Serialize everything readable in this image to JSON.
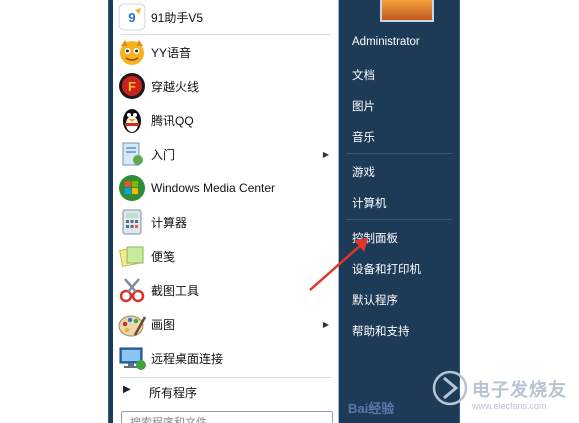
{
  "programs": [
    {
      "label": "91助手V5",
      "icon": "91-assistant-icon"
    },
    {
      "label": "YY语音",
      "icon": "yy-voice-icon"
    },
    {
      "label": "穿越火线",
      "icon": "crossfire-icon"
    },
    {
      "label": "腾讯QQ",
      "icon": "qq-penguin-icon"
    },
    {
      "label": "入门",
      "icon": "getting-started-icon",
      "submenu": true
    },
    {
      "label": "Windows Media Center",
      "icon": "windows-media-center-icon"
    },
    {
      "label": "计算器",
      "icon": "calculator-icon"
    },
    {
      "label": "便笺",
      "icon": "sticky-notes-icon"
    },
    {
      "label": "截图工具",
      "icon": "snipping-tool-icon"
    },
    {
      "label": "画图",
      "icon": "paint-icon",
      "submenu": true
    },
    {
      "label": "远程桌面连接",
      "icon": "remote-desktop-icon"
    }
  ],
  "all_programs": {
    "label": "所有程序"
  },
  "search": {
    "placeholder": "搜索程序和文件"
  },
  "right_menu": {
    "user": "Administrator",
    "items": [
      "文档",
      "图片",
      "音乐",
      "游戏",
      "计算机",
      "控制面板",
      "设备和打印机",
      "默认程序",
      "帮助和支持"
    ]
  },
  "watermarks": {
    "baidu": "Bai经验",
    "elecfans_cn": "电子发烧友",
    "elecfans_en": "www.elecfans.com"
  },
  "colors": {
    "right_pane": "#1d3a57",
    "annotation_arrow": "#e0352b"
  }
}
